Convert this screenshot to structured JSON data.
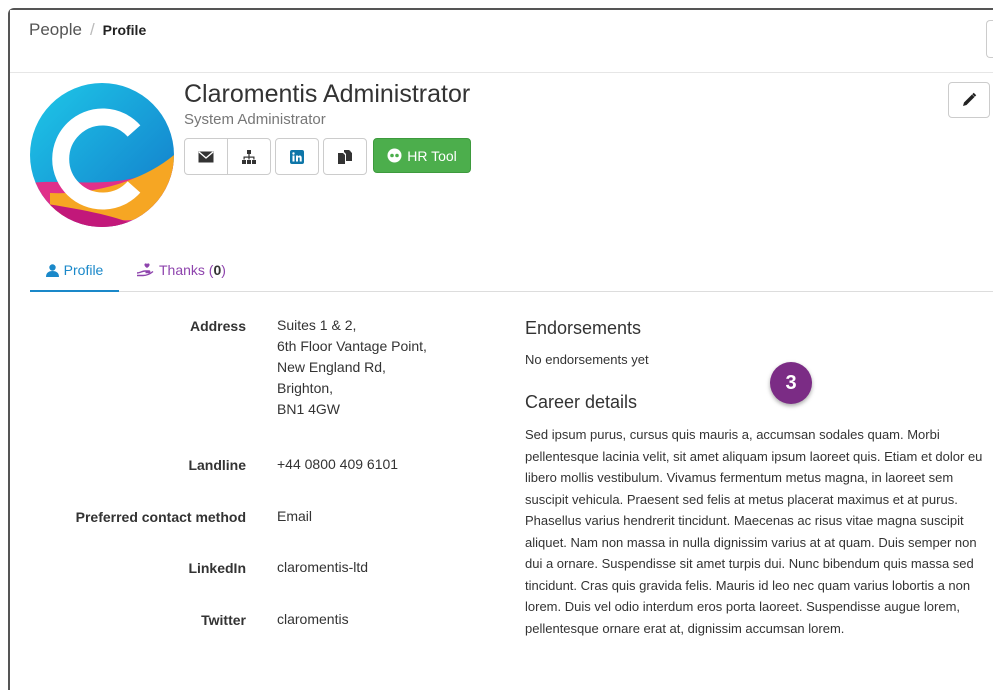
{
  "breadcrumb": {
    "root": "People",
    "separator": "/",
    "current": "Profile"
  },
  "profile": {
    "name": "Claromentis Administrator",
    "role": "System Administrator",
    "avatar_letter": "C"
  },
  "actions": {
    "icons": [
      "envelope-icon",
      "org-chart-icon",
      "linkedin-icon",
      "documents-icon"
    ],
    "hr_tool_label": "HR Tool",
    "edit_icon": "pencil-icon"
  },
  "tabs": {
    "profile_label": "Profile",
    "thanks_label": "Thanks (",
    "thanks_count": "0",
    "thanks_close": ")"
  },
  "fields": {
    "address_label": "Address",
    "address_lines": [
      "Suites 1 & 2,",
      "6th Floor Vantage Point,",
      "New England Rd,",
      "Brighton,",
      "BN1 4GW"
    ],
    "landline_label": "Landline",
    "landline_value": "+44 0800 409 6101",
    "preferred_label": "Preferred contact method",
    "preferred_value": "Email",
    "linkedin_label": "LinkedIn",
    "linkedin_value": "claromentis-ltd",
    "twitter_label": "Twitter",
    "twitter_value": "claromentis"
  },
  "endorsements": {
    "title": "Endorsements",
    "empty_text": "No endorsements yet"
  },
  "career": {
    "title": "Career details",
    "text": "Sed ipsum purus, cursus quis mauris a, accumsan sodales quam. Morbi pellentesque lacinia velit, sit amet aliquam ipsum laoreet quis. Etiam et dolor eu libero mollis vestibulum. Vivamus fermentum metus magna, in laoreet sem suscipit vehicula. Praesent sed felis at metus placerat maximus et at purus. Phasellus varius hendrerit tincidunt. Maecenas ac risus vitae magna suscipit aliquet. Nam non massa in nulla dignissim varius at at quam. Duis semper non dui a ornare. Suspendisse sit amet turpis dui. Nunc bibendum quis massa sed tincidunt. Cras quis gravida felis. Mauris id leo nec quam varius lobortis a non lorem. Duis vel odio interdum eros porta laoreet. Suspendisse augue lorem, pellentesque ornare erat at, dignissim accumsan lorem."
  },
  "step_badge": "3",
  "colors": {
    "accent_blue": "#1a88c9",
    "hr_green": "#4cae4c",
    "thanks_purple": "#8e44ad",
    "badge_purple": "#7b2c85"
  }
}
